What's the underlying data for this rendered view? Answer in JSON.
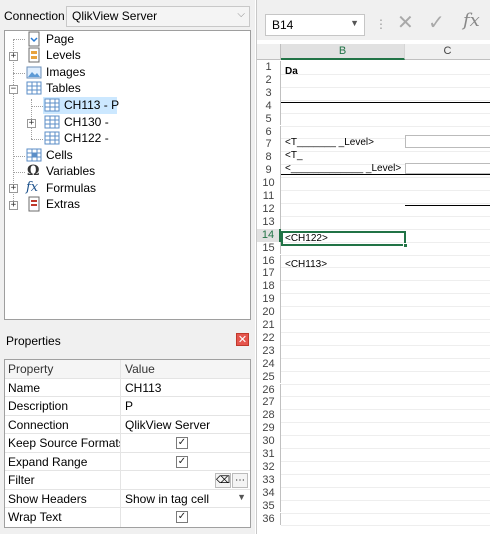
{
  "connection": {
    "label": "Connection",
    "value": "QlikView Server"
  },
  "tree": {
    "page": "Page",
    "levels": "Levels",
    "images": "Images",
    "tables": "Tables",
    "ch113": "CH113 - P",
    "ch130": "CH130 - ",
    "ch122": "CH122 - ",
    "cells": "Cells",
    "variables": "Variables",
    "formulas": "Formulas",
    "extras": "Extras"
  },
  "properties": {
    "title": "Properties",
    "header": {
      "property": "Property",
      "value": "Value"
    },
    "rows": [
      {
        "name": "Name",
        "value": "CH113"
      },
      {
        "name": "Description",
        "value": "P"
      },
      {
        "name": "Connection",
        "value": "QlikView Server"
      },
      {
        "name": "Keep Source Formats",
        "checked": true
      },
      {
        "name": "Expand Range",
        "checked": true
      },
      {
        "name": "Filter",
        "value": ""
      },
      {
        "name": "Show Headers",
        "value": "Show in tag cell"
      },
      {
        "name": "Wrap Text",
        "checked": true
      }
    ]
  },
  "sheet": {
    "name_box": "B14",
    "columns": [
      "B",
      "C"
    ],
    "rows": [
      "1",
      "2",
      "3",
      "4",
      "5",
      "6",
      "7",
      "8",
      "9",
      "10",
      "11",
      "12",
      "13",
      "14",
      "15",
      "16",
      "17",
      "18",
      "19",
      "20",
      "21",
      "22",
      "23",
      "24",
      "25",
      "26",
      "27",
      "28",
      "29",
      "30",
      "31",
      "32",
      "33",
      "34",
      "35",
      "36"
    ],
    "cells": {
      "b1": "Da",
      "b6": "<T_______   _Level>",
      "b7": "<T_",
      "b8": "<_____________ _Level>",
      "b14": "<CH122>",
      "b16": "<CH113>"
    }
  },
  "icons": {
    "cancel": "cancel-x-icon",
    "enter": "check-icon",
    "function": "fx-icon"
  }
}
